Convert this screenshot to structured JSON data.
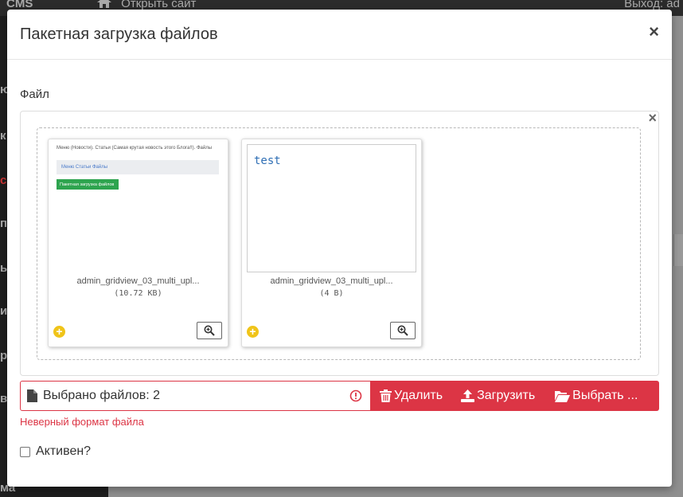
{
  "background": {
    "brand": "CMS",
    "open_site": "Открыть сайт",
    "logout": "Выход: ad",
    "side_fragments": [
      "ю",
      "к",
      "с",
      "п",
      "ь",
      "и",
      "ро",
      "в",
      "ма"
    ]
  },
  "modal": {
    "title": "Пакетная загрузка файлов",
    "close": "×",
    "field_label": "Файл",
    "box_close": "×"
  },
  "files": [
    {
      "name": "admin_gridview_03_multi_upl...",
      "size": "(10.72 KB)",
      "preview": {
        "crumb": "Меню (Новости). Статьи (Самая крутая новость этого Блога!!). Файлы",
        "bar": "Меню   Статьи   Файлы",
        "button": "Пакетная загрузка файлов"
      }
    },
    {
      "name": "admin_gridview_03_multi_upl...",
      "size": "(4 B)",
      "preview_text": "test"
    }
  ],
  "toolbar": {
    "caption": "Выбрано файлов: 2",
    "delete": "Удалить",
    "upload": "Загрузить",
    "browse": "Выбрать ..."
  },
  "error": "Неверный формат файла",
  "checkbox": {
    "label": "Активен?",
    "checked": false
  },
  "colors": {
    "danger": "#dc3545",
    "accent_yellow": "#f0c419"
  }
}
